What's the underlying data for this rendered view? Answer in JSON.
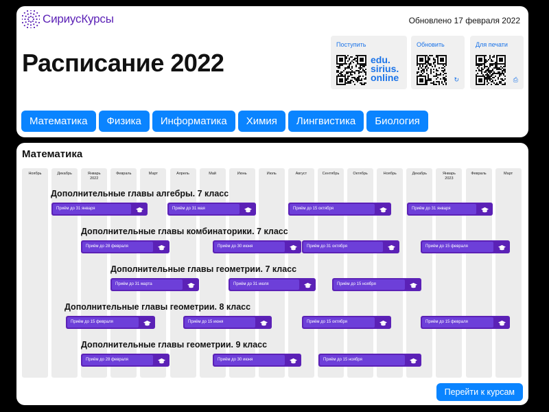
{
  "header": {
    "logo_text": "СириусКурсы",
    "updated": "Обновлено 17 февраля 2022",
    "title": "Расписание 2022"
  },
  "qr": [
    {
      "label": "Поступить",
      "text": "edu.\nsirius.\nonline",
      "icon": "qr-code-icon"
    },
    {
      "label": "Обновить",
      "icon": "refresh-icon"
    },
    {
      "label": "Для печати",
      "icon": "print-icon"
    }
  ],
  "tabs": [
    "Математика",
    "Физика",
    "Информатика",
    "Химия",
    "Лингвистика",
    "Биология"
  ],
  "main": {
    "section_title": "Математика",
    "months": [
      "Ноябрь",
      "Декабрь",
      "Январь 2022",
      "Февраль",
      "Март",
      "Апрель",
      "Май",
      "Июнь",
      "Июль",
      "Август",
      "Сентябрь",
      "Октябрь",
      "Ноябрь",
      "Декабрь",
      "Январь 2023",
      "Февраль",
      "Март"
    ],
    "courses": [
      {
        "title": "Дополнительные главы алгебры. 7 класс",
        "sessions": [
          "Приём до 31 января",
          "Приём до 31 мая",
          "Приём до 15 октября",
          "Приём до 31 января"
        ]
      },
      {
        "title": "Дополнительные главы комбинаторики. 7 класс",
        "sessions": [
          "Приём до 28 февраля",
          "Приём до 30 июня",
          "Приём до 31 октября",
          "Приём до 15 февраля"
        ]
      },
      {
        "title": "Дополнительные главы геометрии. 7 класс",
        "sessions": [
          "Приём до 31 марта",
          "Приём до 31 июля",
          "Приём до 15 ноября"
        ]
      },
      {
        "title": "Дополнительные главы геометрии. 8 класс",
        "sessions": [
          "Приём до 15 февраля",
          "Приём до 15 июня",
          "Приём до 15 октября",
          "Приём до 15 февраля"
        ]
      },
      {
        "title": "Дополнительные главы геометрии. 9 класс",
        "sessions": [
          "Приём до 28 февраля",
          "Приём до 30 июня",
          "Приём до 15 ноября"
        ]
      }
    ],
    "go_button": "Перейти к курсам"
  },
  "colors": {
    "accent": "#0a84ff",
    "brand_purple": "#5b21b6",
    "pill_inner": "#6d3fd9"
  }
}
